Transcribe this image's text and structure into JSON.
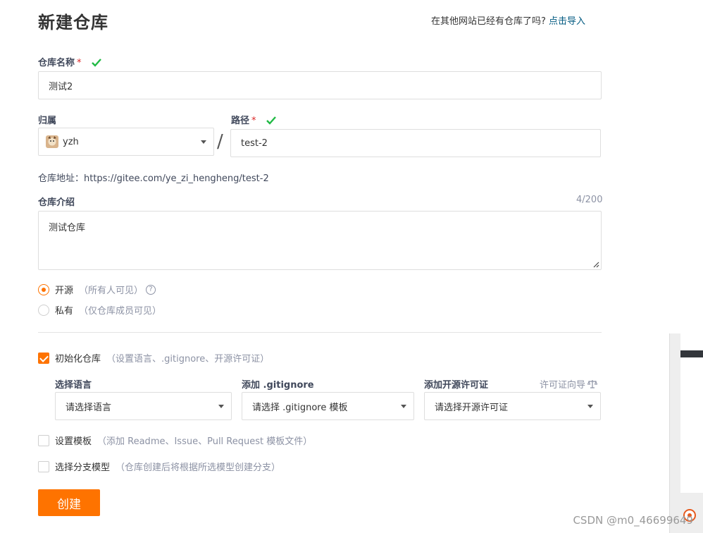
{
  "header": {
    "title": "新建仓库",
    "import_hint": "在其他网站已经有仓库了吗?",
    "import_link": "点击导入"
  },
  "repo_name": {
    "label": "仓库名称",
    "required_mark": "*",
    "value": "测试2"
  },
  "owner": {
    "label": "归属",
    "value": "yzh"
  },
  "separator": "/",
  "path": {
    "label": "路径",
    "required_mark": "*",
    "value": "test-2"
  },
  "repo_address": "仓库地址：https://gitee.com/ye_zi_hengheng/test-2",
  "description": {
    "label": "仓库介绍",
    "counter": "4/200",
    "value": "测试仓库"
  },
  "visibility": {
    "options": [
      {
        "label": "开源",
        "hint": "（所有人可见）",
        "selected": true
      },
      {
        "label": "私有",
        "hint": "（仅仓库成员可见）",
        "selected": false
      }
    ]
  },
  "init_repo": {
    "label": "初始化仓库",
    "hint": "（设置语言、.gitignore、开源许可证）",
    "checked": true
  },
  "language": {
    "label": "选择语言",
    "placeholder": "请选择语言"
  },
  "gitignore": {
    "label": "添加 .gitignore",
    "placeholder": "请选择 .gitignore 模板"
  },
  "license": {
    "label": "添加开源许可证",
    "guide": "许可证向导",
    "placeholder": "请选择开源许可证"
  },
  "template": {
    "label": "设置模板",
    "hint": "（添加 Readme、Issue、Pull Request 模板文件）",
    "checked": false
  },
  "branch_model": {
    "label": "选择分支模型",
    "hint": "（仓库创建后将根据所选模型创建分支）",
    "checked": false
  },
  "create_button": "创建",
  "watermark": "CSDN @m0_46699649",
  "colors": {
    "accent": "#fe7300",
    "link": "#005980",
    "success": "#21ba45",
    "required": "#db2828"
  }
}
